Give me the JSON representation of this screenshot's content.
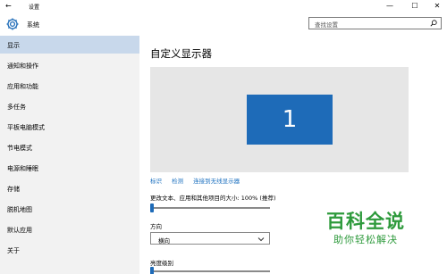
{
  "window": {
    "title": "设置",
    "back_glyph": "←",
    "min_glyph": "—",
    "max_glyph": "☐",
    "close_glyph": "✕"
  },
  "header": {
    "icon": "gear-icon",
    "section": "系统",
    "search_placeholder": "查找设置",
    "search_icon": "search-icon"
  },
  "sidebar": {
    "items": [
      {
        "label": "显示",
        "active": true
      },
      {
        "label": "通知和操作"
      },
      {
        "label": "应用和功能"
      },
      {
        "label": "多任务"
      },
      {
        "label": "平板电脑模式"
      },
      {
        "label": "节电模式"
      },
      {
        "label": "电源和睡眠"
      },
      {
        "label": "存储"
      },
      {
        "label": "脱机地图"
      },
      {
        "label": "默认应用"
      },
      {
        "label": "关于"
      }
    ]
  },
  "main": {
    "title": "自定义显示器",
    "monitor_number": "1",
    "links": [
      "标识",
      "检测",
      "连接到无线显示器"
    ],
    "scale_label": "更改文本、应用和其他项目的大小: 100% (推荐)",
    "scale_value": 0,
    "orientation_label": "方向",
    "orientation_value": "横向",
    "brightness_label": "亮度级别",
    "brightness_value": 0
  },
  "watermark": {
    "title": "百科全说",
    "subtitle": "助你轻松解决"
  },
  "colors": {
    "accent": "#1e6bb8",
    "sidebar_bg": "#f2f2f2",
    "active_item_bg": "#c8d8eb",
    "link": "#1a6fbf",
    "watermark": "#2e9a3c"
  }
}
